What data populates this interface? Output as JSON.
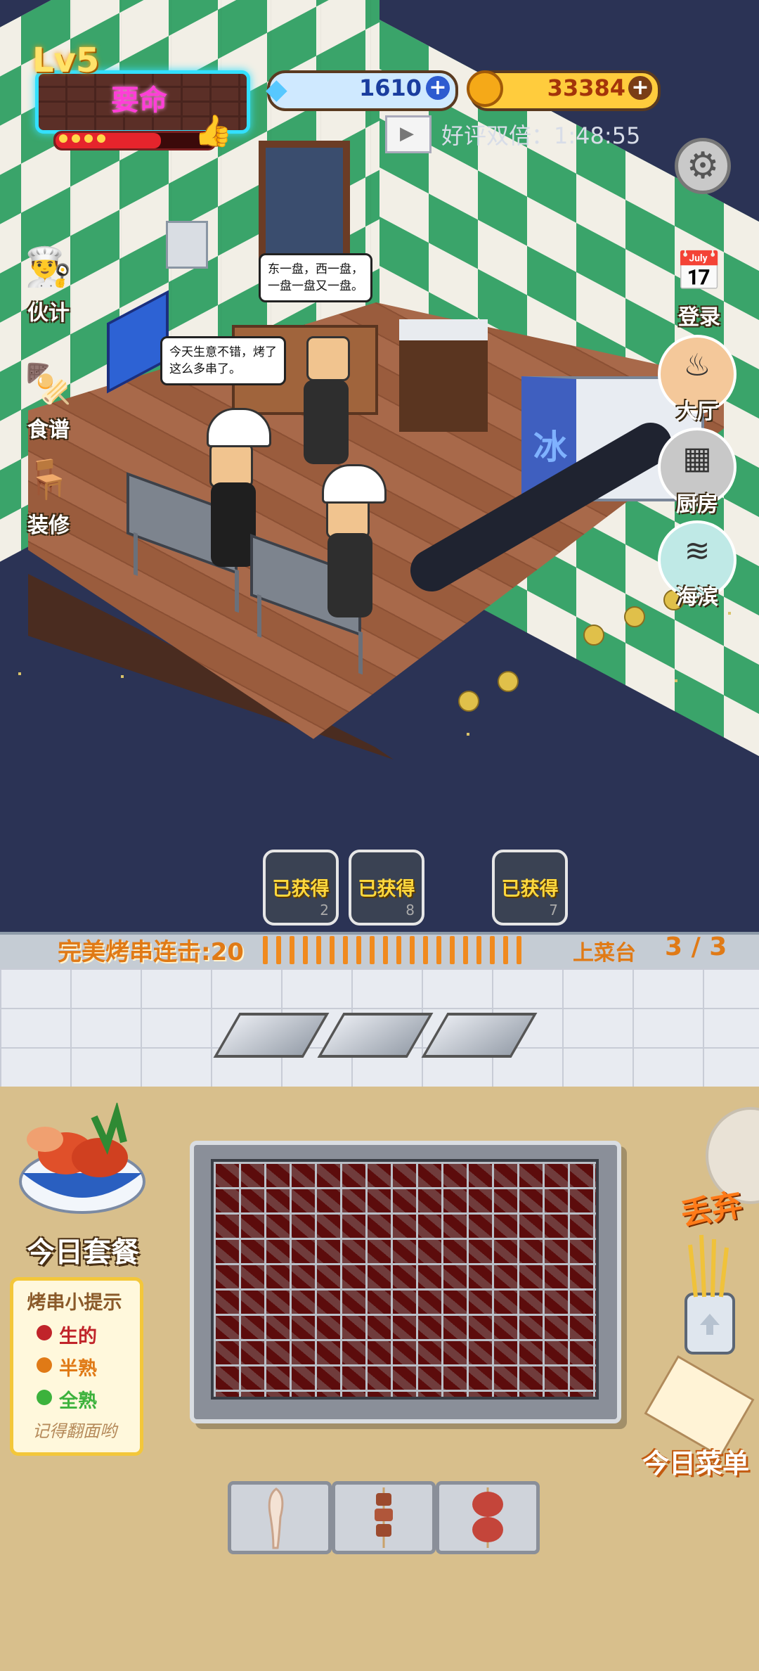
{
  "hud": {
    "level": "Lv5",
    "title": "要命",
    "gems": "1610",
    "coins": "33384",
    "double_reward": "好评双倍：1:48:55"
  },
  "sidebar_left": [
    {
      "label": "伙计",
      "icon": "chef-icon"
    },
    {
      "label": "食谱",
      "icon": "recipe-skewer-icon"
    },
    {
      "label": "装修",
      "icon": "decorate-table-icon"
    }
  ],
  "sidebar_right": [
    {
      "label": "登录",
      "icon": "calendar-icon"
    },
    {
      "label": "大厅",
      "icon": "hall-icon"
    },
    {
      "label": "厨房",
      "icon": "kitchen-icon"
    },
    {
      "label": "海滨",
      "icon": "seaside-icon"
    }
  ],
  "scene": {
    "bubble_1": "东一盘，西一盘，\n一盘一盘又一盘。",
    "bubble_2": "今天生意不错，烤了\n这么多串了。",
    "freezer_label": "冰"
  },
  "achievements": [
    {
      "label": "已获得",
      "count": "2"
    },
    {
      "label": "已获得",
      "count": "8"
    },
    {
      "label": "已获得",
      "count": "7"
    }
  ],
  "combo": {
    "label": "完美烤串连击:20",
    "serving_label": "上菜台",
    "serving_count": "3 / 3"
  },
  "set_meal_label": "今日套餐",
  "tips": {
    "title": "烤串小提示",
    "raw": "生的",
    "half": "半熟",
    "done": "全熟",
    "footer": "记得翻面哟",
    "colors": {
      "raw": "#c0242a",
      "half": "#e07a16",
      "done": "#3cb23c"
    }
  },
  "discard_label": "丢弃",
  "menu_label": "今日菜单",
  "skewers": [
    {
      "icon": "squid-skewer-icon"
    },
    {
      "icon": "meat-skewer-icon"
    },
    {
      "icon": "sausage-skewer-icon"
    }
  ]
}
